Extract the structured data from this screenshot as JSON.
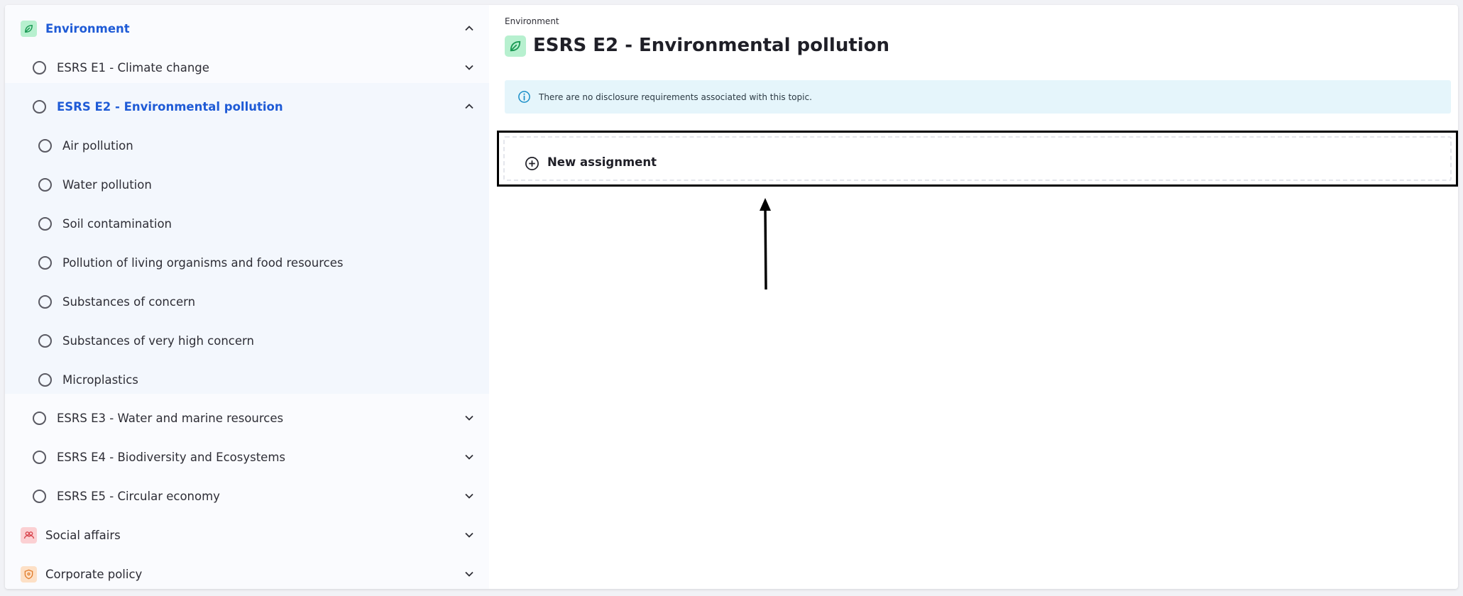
{
  "sidebar": {
    "categories": [
      {
        "label": "Environment",
        "icon": "leaf-icon",
        "expanded": true,
        "color": "#1f5bd6"
      },
      {
        "label": "Social affairs",
        "icon": "people-icon",
        "expanded": false
      },
      {
        "label": "Corporate policy",
        "icon": "shield-icon",
        "expanded": false
      }
    ],
    "topics": [
      {
        "label": "ESRS E1 - Climate change"
      },
      {
        "label": "ESRS E2 - Environmental pollution",
        "active": true
      },
      {
        "label": "ESRS E3 - Water and marine resources"
      },
      {
        "label": "ESRS E4 - Biodiversity and Ecosystems"
      },
      {
        "label": "ESRS E5 - Circular economy"
      }
    ],
    "subtopics": [
      {
        "label": "Air pollution"
      },
      {
        "label": "Water pollution"
      },
      {
        "label": "Soil contamination"
      },
      {
        "label": "Pollution of living organisms and food resources"
      },
      {
        "label": "Substances of concern"
      },
      {
        "label": "Substances of very high concern"
      },
      {
        "label": "Microplastics"
      }
    ]
  },
  "main": {
    "breadcrumb": "Environment",
    "title": "ESRS E2 - Environmental pollution",
    "info_text": "There are no disclosure requirements associated with this topic.",
    "new_assignment_label": "New assignment"
  },
  "colors": {
    "accent": "#1f5bd6",
    "env_icon_bg": "#b7f0cf",
    "social_icon_bg": "#fbd0d3",
    "corporate_icon_bg": "#fde0c6",
    "info_bg": "#e5f5fb"
  }
}
